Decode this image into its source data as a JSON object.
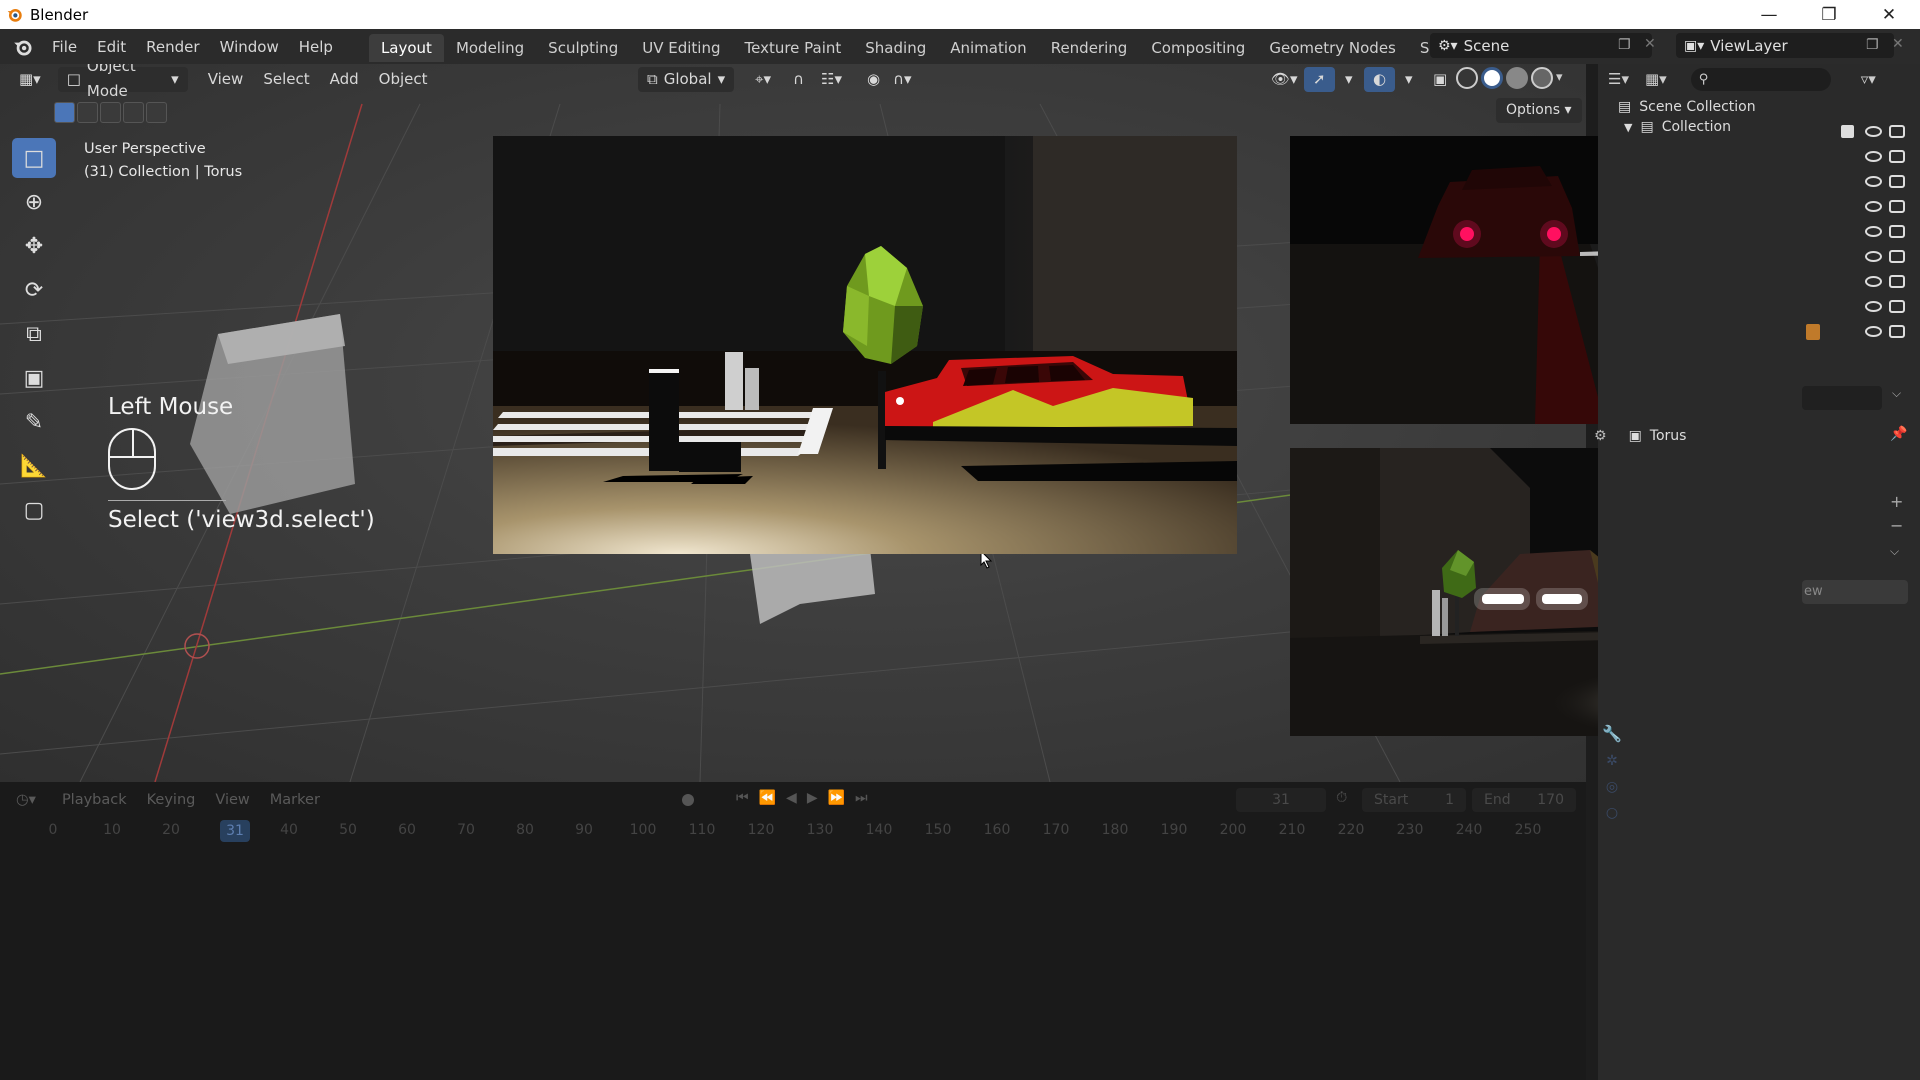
{
  "os": {
    "title": "Blender"
  },
  "menu": [
    "File",
    "Edit",
    "Render",
    "Window",
    "Help"
  ],
  "workspaces": [
    "Layout",
    "Modeling",
    "Sculpting",
    "UV Editing",
    "Texture Paint",
    "Shading",
    "Animation",
    "Rendering",
    "Compositing",
    "Geometry Nodes",
    "Scripting"
  ],
  "active_workspace": "Layout",
  "scene": {
    "name": "Scene",
    "view_layer": "ViewLayer"
  },
  "viewport": {
    "mode": "Object Mode",
    "menus": [
      "View",
      "Select",
      "Add",
      "Object"
    ],
    "orientation": "Global",
    "options_label": "Options",
    "perspective": "User Perspective",
    "context": "(31) Collection | Torus"
  },
  "screencast": {
    "title": "Left Mouse",
    "operator": "Select ('view3d.select')"
  },
  "outliner": {
    "root": "Scene Collection",
    "collection": "Collection",
    "active_object": "Torus"
  },
  "timeline": {
    "menus": [
      "Playback",
      "Keying",
      "View",
      "Marker"
    ],
    "current_frame": "31",
    "start_label": "Start",
    "start": "1",
    "end_label": "End",
    "end": "170",
    "ticks": [
      "0",
      "10",
      "20",
      "31",
      "40",
      "50",
      "60",
      "70",
      "80",
      "90",
      "100",
      "110",
      "120",
      "130",
      "140",
      "150",
      "160",
      "170",
      "180",
      "190",
      "200",
      "210",
      "220",
      "230",
      "240",
      "250"
    ]
  },
  "colors": {
    "accent": "#4b76b8",
    "car_red": "#d01818",
    "car_yellow": "#c4c626",
    "tree_green": "#8abf2a"
  }
}
